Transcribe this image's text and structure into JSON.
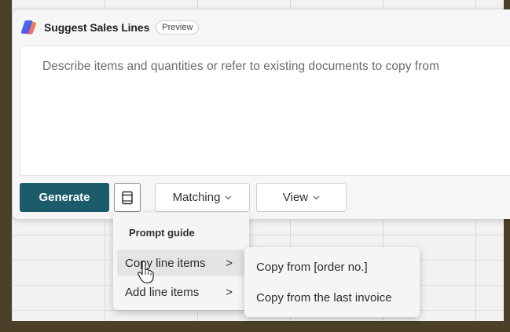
{
  "panel": {
    "title": "Suggest Sales Lines",
    "badge": "Preview",
    "logo_icon": "copilot-logo-icon"
  },
  "prompt": {
    "placeholder": "Describe items and quantities or refer to existing documents to copy from",
    "value": ""
  },
  "toolbar": {
    "generate_label": "Generate",
    "prompt_guide_icon": "prompt-guide-book-icon",
    "matching_label": "Matching",
    "view_label": "View",
    "chevron": "⌄"
  },
  "prompt_guide_menu": {
    "heading": "Prompt guide",
    "items": [
      {
        "label": "Copy line items",
        "arrow": ">"
      },
      {
        "label": "Add line items",
        "arrow": ">"
      }
    ]
  },
  "submenu": {
    "items": [
      {
        "label": "Copy from [order no.]"
      },
      {
        "label": "Copy from the last invoice"
      }
    ]
  },
  "colors": {
    "generate_bg": "#1b5b6a",
    "panel_bg": "#f6f6f6",
    "menu_bg": "#f5f5f5"
  }
}
